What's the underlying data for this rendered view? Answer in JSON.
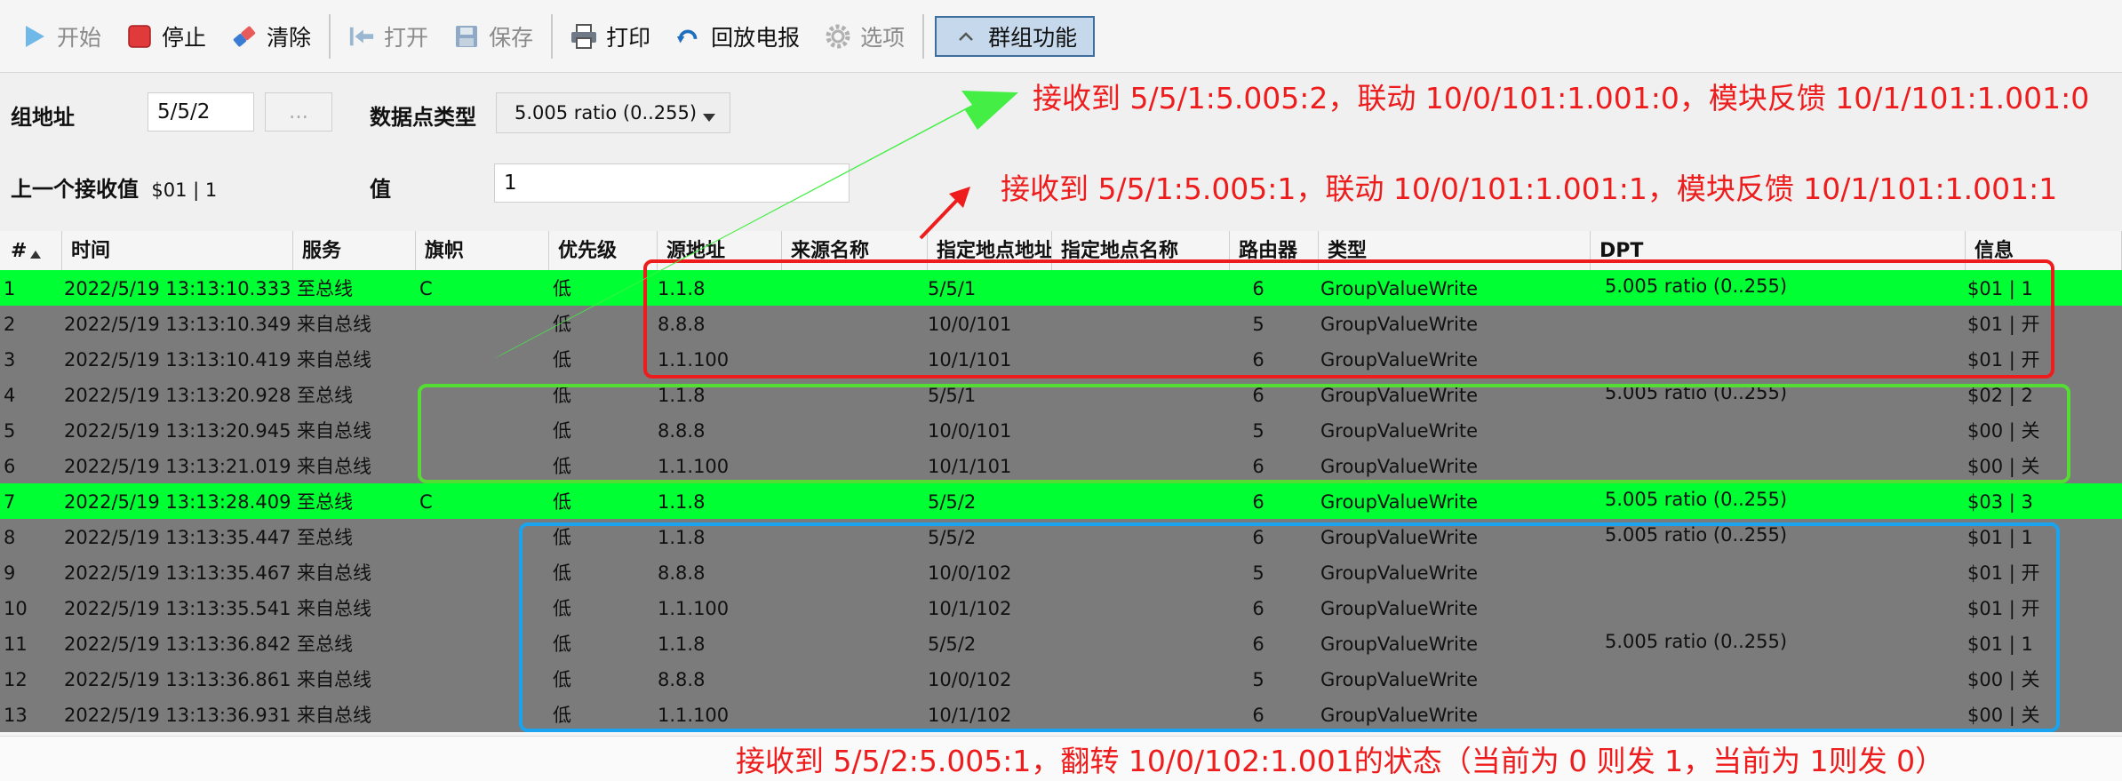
{
  "toolbar": {
    "start": "开始",
    "stop": "停止",
    "clear": "清除",
    "open": "打开",
    "save": "保存",
    "print": "打印",
    "replay": "回放电报",
    "options": "选项",
    "group": "群组功能"
  },
  "form": {
    "group_address_label": "组地址",
    "group_address_value": "5/5/2",
    "browse_button": "...",
    "dpt_label": "数据点类型",
    "dpt_value": "5.005 ratio (0..255)",
    "last_value_label": "上一个接收值",
    "last_value": "$01 | 1",
    "value_label": "值",
    "value": "1"
  },
  "grid": {
    "columns": [
      "#",
      "时间",
      "服务",
      "旗帜",
      "优先级",
      "源地址",
      "来源名称",
      "指定地点地址",
      "指定地点名称",
      "路由器",
      "类型",
      "DPT",
      "信息"
    ],
    "rows": [
      {
        "no": "1",
        "time": "2022/5/19 13:13:10.333",
        "service": "至总线",
        "flag": "C",
        "priority": "低",
        "src": "1.1.8",
        "src_name": "",
        "dest": "5/5/1",
        "dest_name": "",
        "router": "6",
        "type": "GroupValueWrite",
        "dpt": "5.005 ratio (0..255)",
        "info": "$01 | 1",
        "color": "green"
      },
      {
        "no": "2",
        "time": "2022/5/19 13:13:10.349",
        "service": "来自总线",
        "flag": "",
        "priority": "低",
        "src": "8.8.8",
        "src_name": "",
        "dest": "10/0/101",
        "dest_name": "",
        "router": "5",
        "type": "GroupValueWrite",
        "dpt": "",
        "info": "$01 | 开",
        "color": "gray"
      },
      {
        "no": "3",
        "time": "2022/5/19 13:13:10.419",
        "service": "来自总线",
        "flag": "",
        "priority": "低",
        "src": "1.1.100",
        "src_name": "",
        "dest": "10/1/101",
        "dest_name": "",
        "router": "6",
        "type": "GroupValueWrite",
        "dpt": "",
        "info": "$01 | 开",
        "color": "gray"
      },
      {
        "no": "4",
        "time": "2022/5/19 13:13:20.928",
        "service": "至总线",
        "flag": "",
        "priority": "低",
        "src": "1.1.8",
        "src_name": "",
        "dest": "5/5/1",
        "dest_name": "",
        "router": "6",
        "type": "GroupValueWrite",
        "dpt": "5.005 ratio (0..255)",
        "info": "$02 | 2",
        "color": "gray"
      },
      {
        "no": "5",
        "time": "2022/5/19 13:13:20.945",
        "service": "来自总线",
        "flag": "",
        "priority": "低",
        "src": "8.8.8",
        "src_name": "",
        "dest": "10/0/101",
        "dest_name": "",
        "router": "5",
        "type": "GroupValueWrite",
        "dpt": "",
        "info": "$00 | 关",
        "color": "gray"
      },
      {
        "no": "6",
        "time": "2022/5/19 13:13:21.019",
        "service": "来自总线",
        "flag": "",
        "priority": "低",
        "src": "1.1.100",
        "src_name": "",
        "dest": "10/1/101",
        "dest_name": "",
        "router": "6",
        "type": "GroupValueWrite",
        "dpt": "",
        "info": "$00 | 关",
        "color": "gray"
      },
      {
        "no": "7",
        "time": "2022/5/19 13:13:28.409",
        "service": "至总线",
        "flag": "C",
        "priority": "低",
        "src": "1.1.8",
        "src_name": "",
        "dest": "5/5/2",
        "dest_name": "",
        "router": "6",
        "type": "GroupValueWrite",
        "dpt": "5.005 ratio (0..255)",
        "info": "$03 | 3",
        "color": "green"
      },
      {
        "no": "8",
        "time": "2022/5/19 13:13:35.447",
        "service": "至总线",
        "flag": "",
        "priority": "低",
        "src": "1.1.8",
        "src_name": "",
        "dest": "5/5/2",
        "dest_name": "",
        "router": "6",
        "type": "GroupValueWrite",
        "dpt": "5.005 ratio (0..255)",
        "info": "$01 | 1",
        "color": "gray"
      },
      {
        "no": "9",
        "time": "2022/5/19 13:13:35.467",
        "service": "来自总线",
        "flag": "",
        "priority": "低",
        "src": "8.8.8",
        "src_name": "",
        "dest": "10/0/102",
        "dest_name": "",
        "router": "5",
        "type": "GroupValueWrite",
        "dpt": "",
        "info": "$01 | 开",
        "color": "gray"
      },
      {
        "no": "10",
        "time": "2022/5/19 13:13:35.541",
        "service": "来自总线",
        "flag": "",
        "priority": "低",
        "src": "1.1.100",
        "src_name": "",
        "dest": "10/1/102",
        "dest_name": "",
        "router": "6",
        "type": "GroupValueWrite",
        "dpt": "",
        "info": "$01 | 开",
        "color": "gray"
      },
      {
        "no": "11",
        "time": "2022/5/19 13:13:36.842",
        "service": "至总线",
        "flag": "",
        "priority": "低",
        "src": "1.1.8",
        "src_name": "",
        "dest": "5/5/2",
        "dest_name": "",
        "router": "6",
        "type": "GroupValueWrite",
        "dpt": "5.005 ratio (0..255)",
        "info": "$01 | 1",
        "color": "gray"
      },
      {
        "no": "12",
        "time": "2022/5/19 13:13:36.861",
        "service": "来自总线",
        "flag": "",
        "priority": "低",
        "src": "8.8.8",
        "src_name": "",
        "dest": "10/0/102",
        "dest_name": "",
        "router": "5",
        "type": "GroupValueWrite",
        "dpt": "",
        "info": "$00 | 关",
        "color": "gray"
      },
      {
        "no": "13",
        "time": "2022/5/19 13:13:36.931",
        "service": "来自总线",
        "flag": "",
        "priority": "低",
        "src": "1.1.100",
        "src_name": "",
        "dest": "10/1/102",
        "dest_name": "",
        "router": "6",
        "type": "GroupValueWrite",
        "dpt": "",
        "info": "$00 | 关",
        "color": "gray"
      }
    ]
  },
  "annotations": {
    "note1": "接收到 5/5/1:5.005:2，联动 10/0/101:1.001:0，模块反馈 10/1/101:1.001:0",
    "note2": "接收到 5/5/1:5.005:1，联动 10/0/101:1.001:1，模块反馈 10/1/101:1.001:1",
    "note3": "接收到 5/5/2:5.005:1，翻转 10/0/102:1.001的状态（当前为 0 则发 1，当前为 1则发 0）"
  },
  "colors": {
    "row_green": "#00ff33",
    "row_gray": "#7b7b7b",
    "annotation_red": "#ee1c1c",
    "box_green": "#55dd33",
    "box_blue": "#1aa3ee",
    "arrow_green": "#44ee44"
  },
  "icons": {
    "start": "play-icon",
    "stop": "stop-square-icon",
    "clear": "eraser-icon",
    "open": "open-arrow-icon",
    "save": "floppy-disk-icon",
    "print": "printer-icon",
    "replay": "replay-icon",
    "options": "gear-icon",
    "group": "chevron-up-icon"
  }
}
